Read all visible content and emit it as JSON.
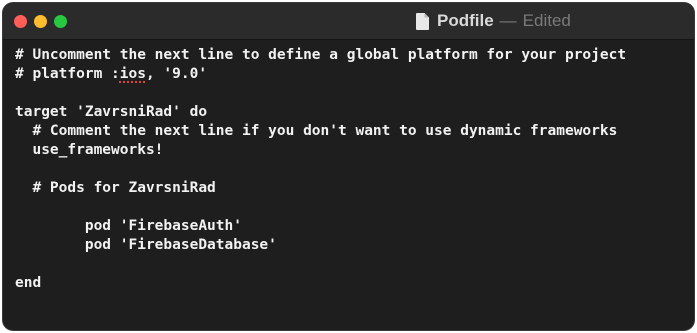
{
  "window": {
    "title": "Podfile",
    "separator": "—",
    "status": "Edited"
  },
  "editor": {
    "lines": [
      "# Uncomment the next line to define a global platform for your project",
      "# platform :ios, '9.0'",
      "",
      "target 'ZavrsniRad' do",
      "  # Comment the next line if you don't want to use dynamic frameworks",
      "  use_frameworks!",
      "",
      "  # Pods for ZavrsniRad",
      "",
      "        pod 'FirebaseAuth'",
      "        pod 'FirebaseDatabase'",
      "",
      "end"
    ],
    "misspelled_word": "ios"
  },
  "colors": {
    "background": "#1e1e1e",
    "titlebar": "#2b2b2b",
    "text": "#f2f2f2",
    "close": "#ff5f57",
    "minimize": "#febc2e",
    "maximize": "#28c840"
  },
  "icons": {
    "close": "close-icon",
    "minimize": "minimize-icon",
    "maximize": "maximize-icon",
    "document": "document-icon"
  }
}
